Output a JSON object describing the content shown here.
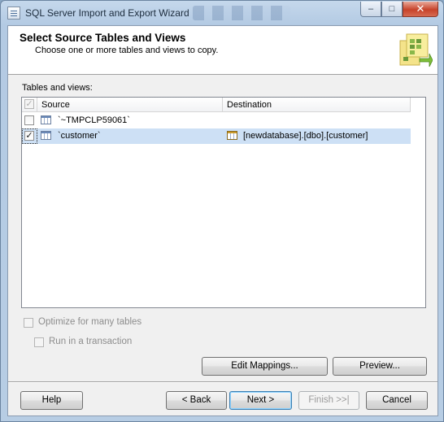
{
  "window": {
    "title": "SQL Server Import and Export Wizard"
  },
  "header": {
    "title": "Select Source Tables and Views",
    "subtitle": "Choose one or more tables and views to copy.",
    "graphic_icon": "wizard-tables-graphic"
  },
  "tables_label": "Tables and views:",
  "columns": {
    "source": "Source",
    "destination": "Destination"
  },
  "rows": [
    {
      "source": "`~TMPCLP59061`",
      "destination": "",
      "checked": false,
      "selected": false
    },
    {
      "source": "`customer`",
      "destination": "[newdatabase].[dbo].[customer]",
      "checked": true,
      "selected": true
    }
  ],
  "options": {
    "optimize_label": "Optimize for many tables",
    "transaction_label": "Run in a transaction"
  },
  "buttons": {
    "edit_mappings": "Edit Mappings...",
    "preview": "Preview...",
    "help": "Help",
    "back": "< Back",
    "next": "Next >",
    "finish": "Finish >>|",
    "cancel": "Cancel"
  },
  "title_buttons": {
    "minimize": "–",
    "maximize": "□",
    "close": "✕"
  },
  "colors": {
    "selected_row": "#cde0f5",
    "close_button": "#c7432a",
    "default_button_border": "#3c7fb1"
  }
}
